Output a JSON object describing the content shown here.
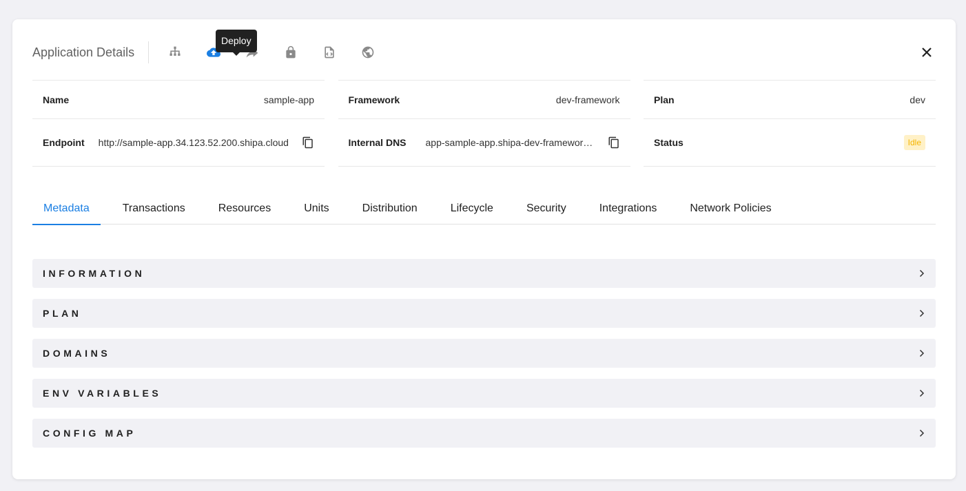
{
  "header": {
    "title": "Application Details",
    "tooltip": "Deploy",
    "icons": [
      "sitemap-icon",
      "cloud-upload-icon",
      "share-icon",
      "lock-icon",
      "code-file-icon",
      "globe-icon"
    ],
    "active_icon": "cloud-upload-icon",
    "accent_color": "#1b7fe3"
  },
  "details": {
    "name_label": "Name",
    "name_value": "sample-app",
    "framework_label": "Framework",
    "framework_value": "dev-framework",
    "plan_label": "Plan",
    "plan_value": "dev",
    "endpoint_label": "Endpoint",
    "endpoint_value": "http://sample-app.34.123.52.200.shipa.cloud",
    "internal_dns_label": "Internal DNS",
    "internal_dns_value": "app-sample-app.shipa-dev-framework.svc.cluster.local",
    "status_label": "Status",
    "status_value": "Idle",
    "status_color": "#f5b400"
  },
  "tabs": [
    {
      "label": "Metadata",
      "active": true
    },
    {
      "label": "Transactions"
    },
    {
      "label": "Resources"
    },
    {
      "label": "Units"
    },
    {
      "label": "Distribution"
    },
    {
      "label": "Lifecycle"
    },
    {
      "label": "Security"
    },
    {
      "label": "Integrations"
    },
    {
      "label": "Network Policies"
    }
  ],
  "sections": [
    {
      "label": "INFORMATION"
    },
    {
      "label": "PLAN"
    },
    {
      "label": "DOMAINS"
    },
    {
      "label": "ENV VARIABLES"
    },
    {
      "label": "CONFIG MAP"
    }
  ]
}
